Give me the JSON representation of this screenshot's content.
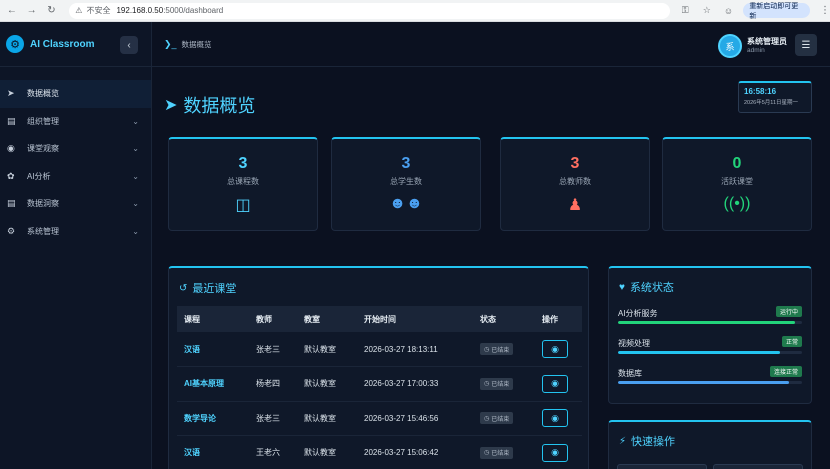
{
  "browser": {
    "back_icon": "arrow-left-icon",
    "insecure_label": "不安全",
    "url_host": "192.168.0.50",
    "url_path": ":5000/dashboard",
    "update_label": "重新启动即可更新"
  },
  "sidebar": {
    "brand": "AI Classroom",
    "items": [
      {
        "label": "数据概览",
        "icon": "rocket-icon",
        "active": true
      },
      {
        "label": "组织管理",
        "icon": "book-icon"
      },
      {
        "label": "课堂观察",
        "icon": "eye-icon"
      },
      {
        "label": "AI分析",
        "icon": "brain-icon"
      },
      {
        "label": "数据洞察",
        "icon": "chart-icon"
      },
      {
        "label": "系统管理",
        "icon": "gears-icon"
      }
    ]
  },
  "header": {
    "breadcrumb": "数据概览",
    "user_initial": "系",
    "user_name": "系统管理员",
    "user_role": "admin"
  },
  "page": {
    "title": "数据概览",
    "clock_time": "16:58:16",
    "clock_date": "2026年5月11日星期一"
  },
  "stats": [
    {
      "value": "3",
      "label": "总课程数",
      "color": "#4fd3ff",
      "icon": "chalkboard-icon"
    },
    {
      "value": "3",
      "label": "总学生数",
      "color": "#4a9ff0",
      "icon": "users-icon"
    },
    {
      "value": "3",
      "label": "总教师数",
      "color": "#ff6f61",
      "icon": "teacher-icon"
    },
    {
      "value": "0",
      "label": "活跃课堂",
      "color": "#22d37a",
      "icon": "broadcast-icon"
    }
  ],
  "recent": {
    "title": "最近课堂",
    "columns": [
      "课程",
      "教师",
      "教室",
      "开始时间",
      "状态",
      "操作"
    ],
    "rows": [
      {
        "course": "汉语",
        "teacher": "张老三",
        "room": "默认教室",
        "start": "2026-03-27 18:13:11",
        "status": "已结束"
      },
      {
        "course": "AI基本原理",
        "teacher": "杨老四",
        "room": "默认教室",
        "start": "2026-03-27 17:00:33",
        "status": "已结束"
      },
      {
        "course": "数学导论",
        "teacher": "张老三",
        "room": "默认教室",
        "start": "2026-03-27 15:46:56",
        "status": "已结束"
      },
      {
        "course": "汉语",
        "teacher": "王老六",
        "room": "默认教室",
        "start": "2026-03-27 15:06:42",
        "status": "已结束"
      }
    ]
  },
  "system": {
    "title": "系统状态",
    "services": [
      {
        "name": "AI分析服务",
        "status": "运行中",
        "level": 0.96,
        "color": "#22d37a"
      },
      {
        "name": "视频处理",
        "status": "正常",
        "level": 0.88,
        "color": "#23c4f0"
      },
      {
        "name": "数据库",
        "status": "连接正常",
        "level": 0.93,
        "color": "#4a9ff0"
      }
    ]
  },
  "quick": {
    "title": "快速操作"
  }
}
